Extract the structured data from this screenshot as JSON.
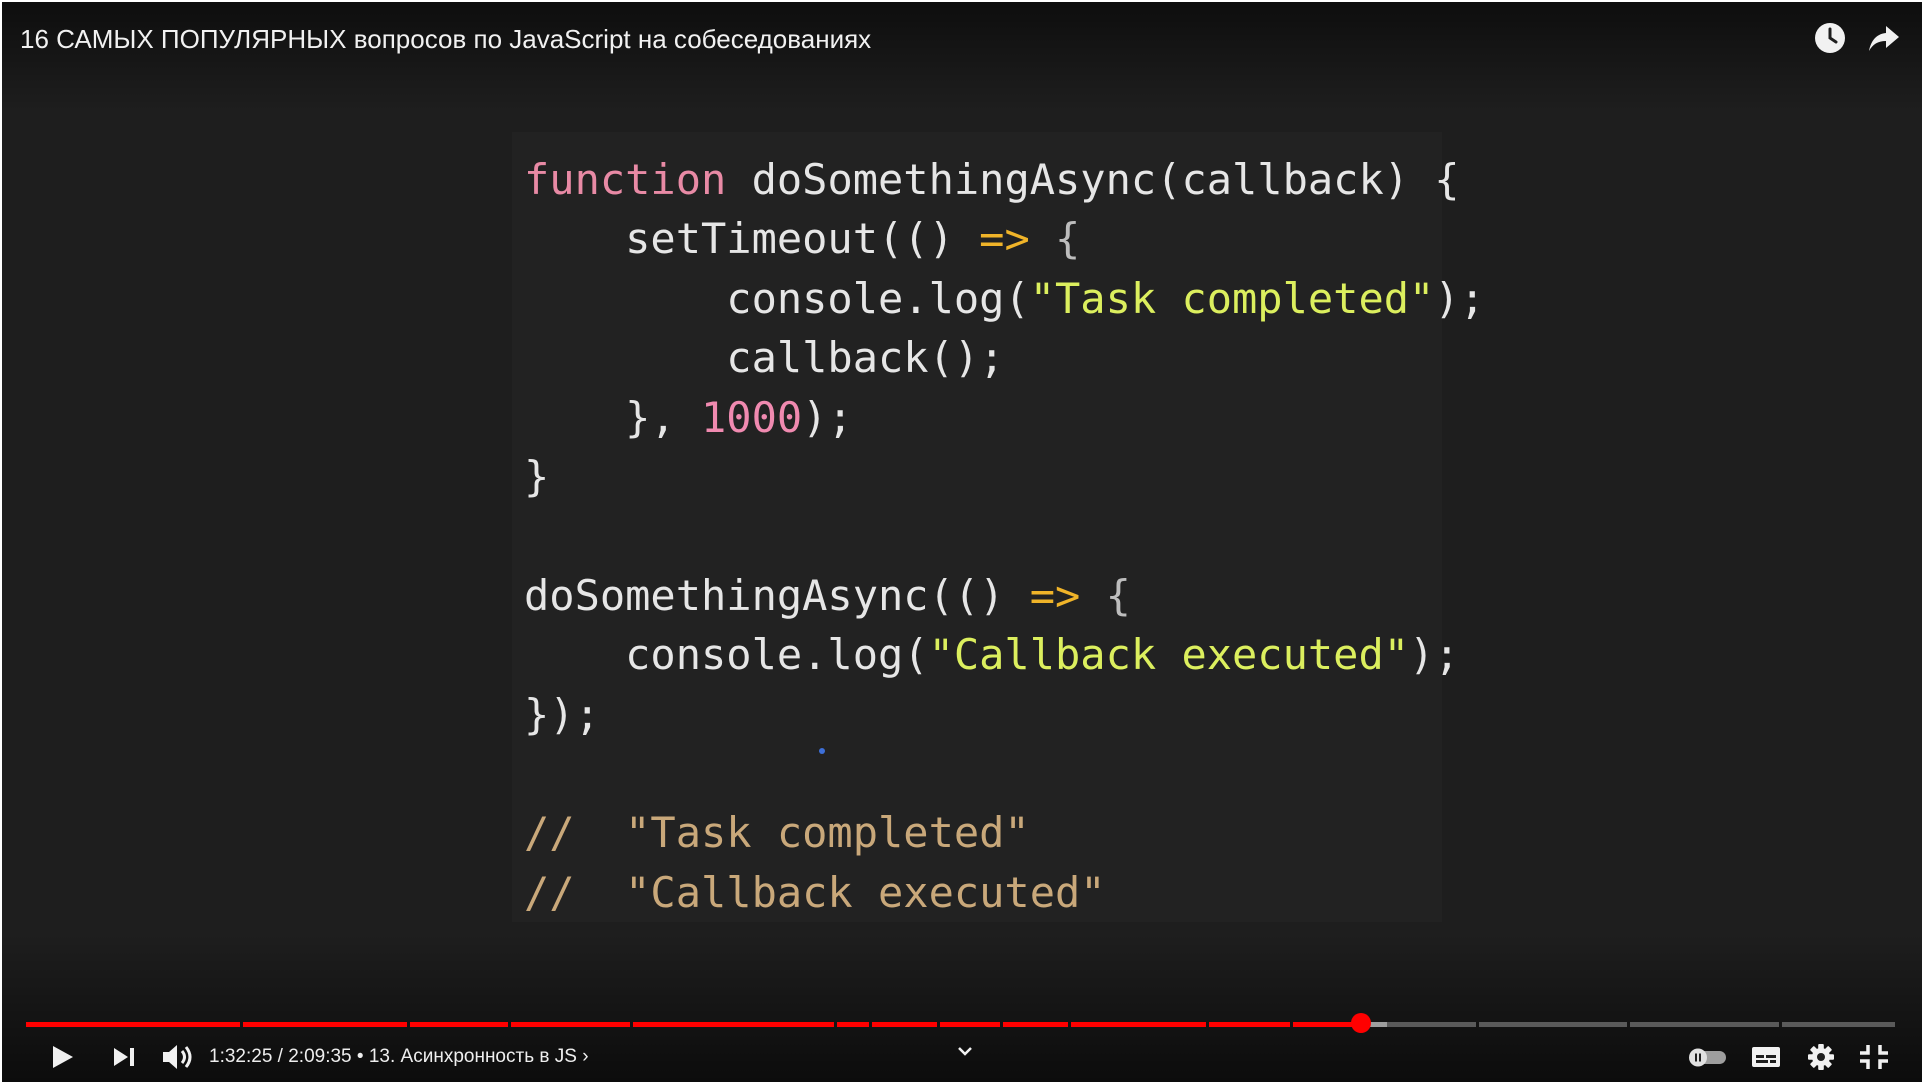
{
  "video": {
    "title": "16 САМЫХ ПОПУЛЯРНЫХ вопросов по JavaScript на собеседованиях"
  },
  "top_actions": {
    "watch_later_icon": "clock-icon",
    "share_icon": "share-arrow-icon"
  },
  "code_slide": {
    "lines": [
      [
        "function",
        " doSomethingAsync(callback) {"
      ],
      [
        "    setTimeout(() ",
        "=>",
        " {"
      ],
      [
        "        console.log(",
        "\"Task completed\"",
        ");"
      ],
      [
        "        callback();"
      ],
      [
        "    }, ",
        "1000",
        ");"
      ],
      [
        "}"
      ],
      [
        ""
      ],
      [
        "doSomethingAsync(() ",
        "=>",
        " {"
      ],
      [
        "    console.log(",
        "\"Callback executed\"",
        ");"
      ],
      [
        "});"
      ],
      [
        ""
      ],
      [
        "//  \"Task completed\""
      ],
      [
        "//  \"Callback executed\""
      ]
    ]
  },
  "player": {
    "current_time": "1:32:25",
    "duration": "2:09:35",
    "time_display": "1:32:25 / 2:09:35",
    "separator": "•",
    "chapter": "13. Асинхронность в JS",
    "chapter_arrow": "›",
    "progress_fraction": 0.713,
    "buffered_fraction": 0.727,
    "colors": {
      "progress": "#ff0000",
      "buffered": "#9e9e9e",
      "track": "#555555",
      "background": "#1e1e1e"
    }
  },
  "controls": {
    "play_icon": "play-icon",
    "next_icon": "next-icon",
    "volume_icon": "volume-icon",
    "chevron_icon": "chevron-down-icon",
    "autoplay_icon": "autoplay-toggle-icon",
    "subtitles_icon": "subtitles-icon",
    "settings_icon": "gear-icon",
    "exit_fullscreen_icon": "exit-fullscreen-icon"
  }
}
